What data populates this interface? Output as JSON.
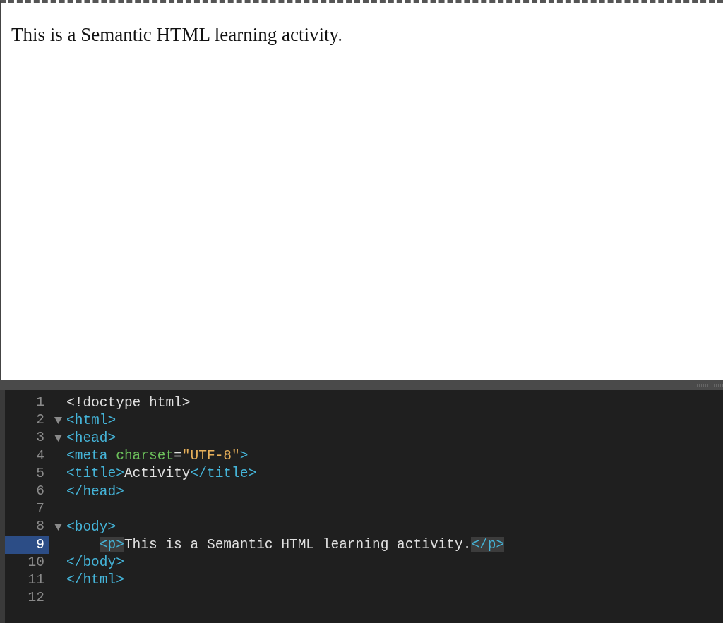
{
  "preview": {
    "text": "This is a Semantic HTML learning activity."
  },
  "editor": {
    "lines": [
      {
        "number": "1",
        "selected": false,
        "foldable": false,
        "tokens": [
          {
            "kind": "plain",
            "text": "<!doctype html>",
            "highlighted": false
          }
        ]
      },
      {
        "number": "2",
        "selected": false,
        "foldable": true,
        "tokens": [
          {
            "kind": "tag",
            "text": "<html>",
            "highlighted": false
          }
        ]
      },
      {
        "number": "3",
        "selected": false,
        "foldable": true,
        "tokens": [
          {
            "kind": "tag",
            "text": "<head>",
            "highlighted": false
          }
        ]
      },
      {
        "number": "4",
        "selected": false,
        "foldable": false,
        "tokens": [
          {
            "kind": "tag",
            "text": "<meta ",
            "highlighted": false
          },
          {
            "kind": "attr",
            "text": "charset",
            "highlighted": false
          },
          {
            "kind": "plain",
            "text": "=",
            "highlighted": false
          },
          {
            "kind": "string",
            "text": "\"UTF-8\"",
            "highlighted": false
          },
          {
            "kind": "tag",
            "text": ">",
            "highlighted": false
          }
        ]
      },
      {
        "number": "5",
        "selected": false,
        "foldable": false,
        "tokens": [
          {
            "kind": "tag",
            "text": "<title>",
            "highlighted": false
          },
          {
            "kind": "plain",
            "text": "Activity",
            "highlighted": false
          },
          {
            "kind": "tag",
            "text": "</title>",
            "highlighted": false
          }
        ]
      },
      {
        "number": "6",
        "selected": false,
        "foldable": false,
        "tokens": [
          {
            "kind": "tag",
            "text": "</head>",
            "highlighted": false
          }
        ]
      },
      {
        "number": "7",
        "selected": false,
        "foldable": false
      },
      {
        "number": "8",
        "selected": false,
        "foldable": true,
        "tokens": [
          {
            "kind": "tag",
            "text": "<body>",
            "highlighted": false
          }
        ]
      },
      {
        "number": "9",
        "selected": true,
        "foldable": false,
        "indented": true,
        "tokens": [
          {
            "kind": "tag",
            "text": "<p>",
            "highlighted": true
          },
          {
            "kind": "plain",
            "text": "This is a Semantic HTML learning activity.",
            "highlighted": false
          },
          {
            "kind": "tag",
            "text": "</p>",
            "highlighted": true
          }
        ]
      },
      {
        "number": "10",
        "selected": false,
        "foldable": false,
        "tokens": [
          {
            "kind": "tag",
            "text": "</body>",
            "highlighted": false
          }
        ]
      },
      {
        "number": "11",
        "selected": false,
        "foldable": false,
        "tokens": [
          {
            "kind": "tag",
            "text": "</html>",
            "highlighted": false
          }
        ]
      },
      {
        "number": "12",
        "selected": false,
        "foldable": false
      }
    ]
  }
}
